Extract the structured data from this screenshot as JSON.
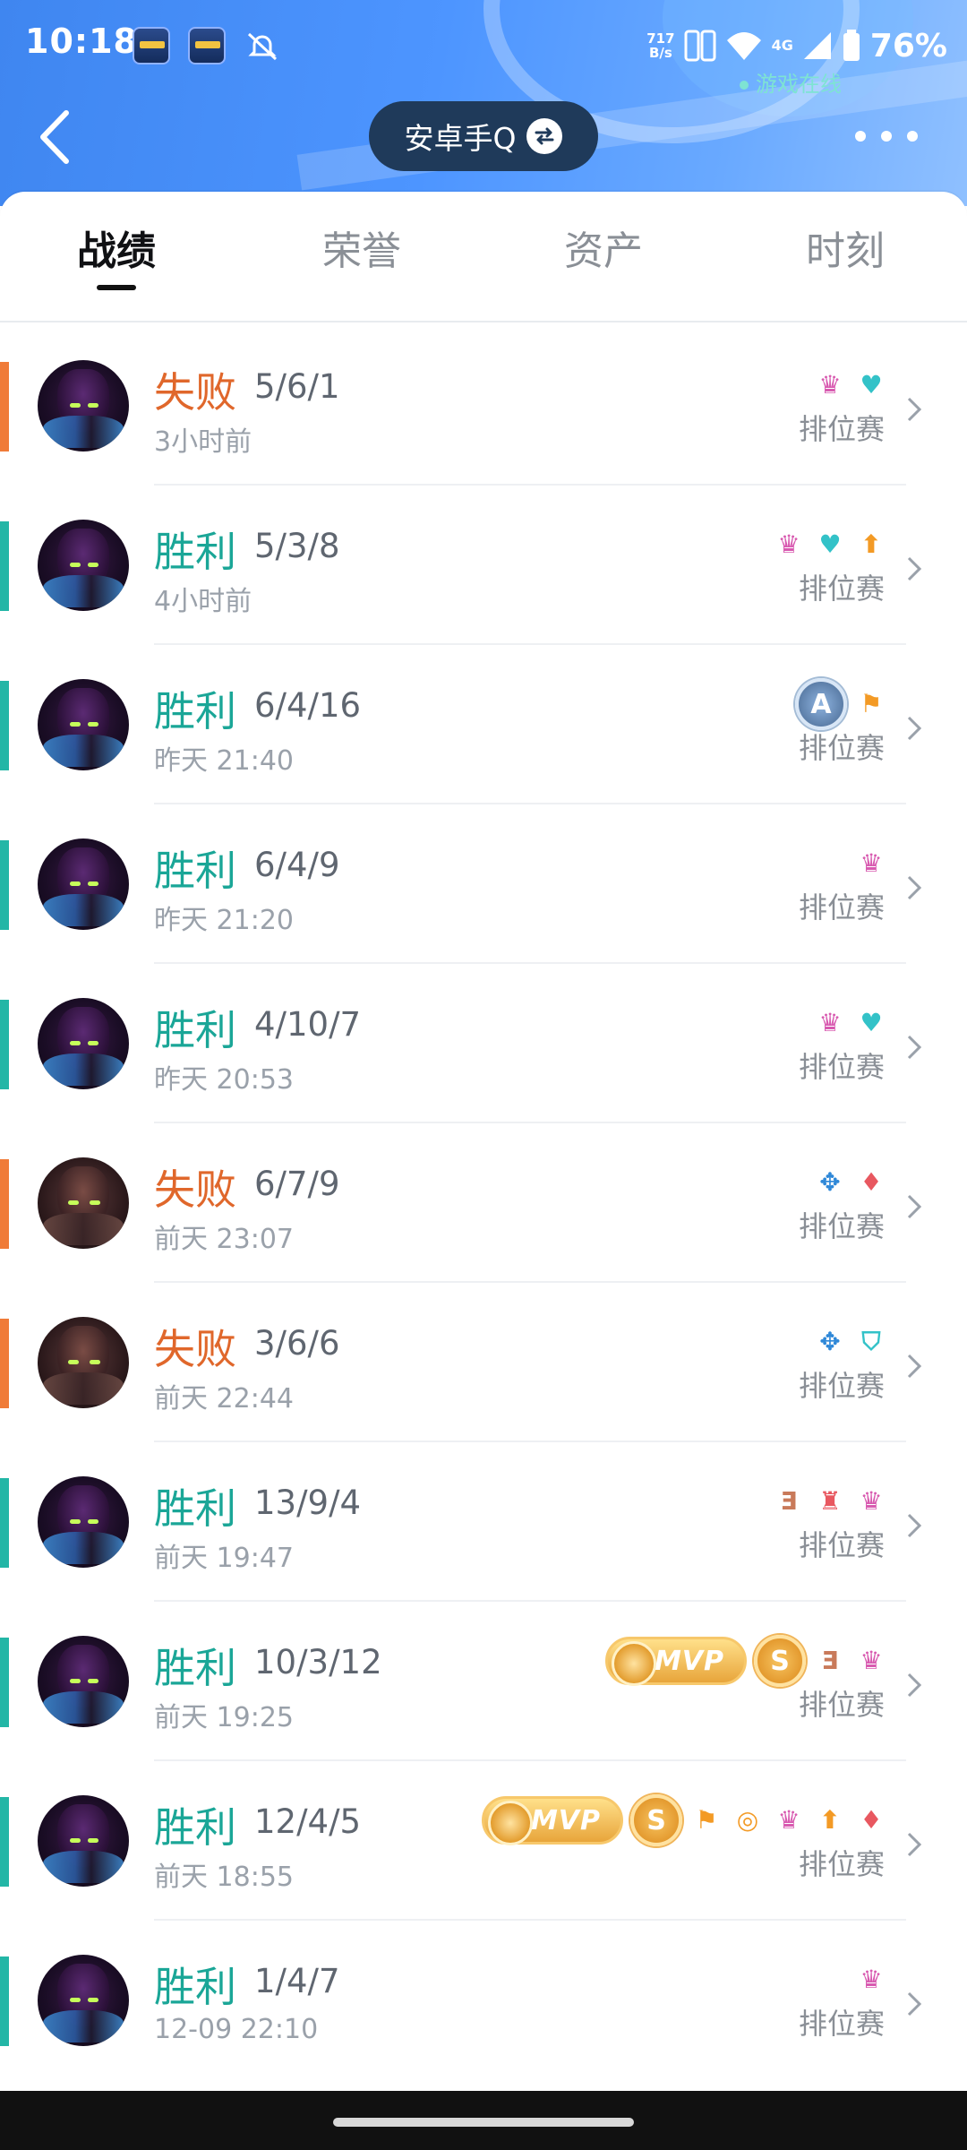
{
  "status_bar": {
    "time": "10:18",
    "net_speed_value": "717",
    "net_speed_unit": "B/s",
    "signal": "4G",
    "battery": "76%",
    "online_text": "游戏在线"
  },
  "header": {
    "account_label": "安卓手Q"
  },
  "tabs": [
    {
      "label": "战绩",
      "active": true
    },
    {
      "label": "荣誉",
      "active": false
    },
    {
      "label": "资产",
      "active": false
    },
    {
      "label": "时刻",
      "active": false
    }
  ],
  "matches": [
    {
      "result": "失败",
      "outcome": "lose",
      "kda": "5/6/1",
      "time": "3小时前",
      "mode": "排位赛",
      "badges": [
        "demon-icon",
        "heart-plus-icon"
      ]
    },
    {
      "result": "胜利",
      "outcome": "win",
      "kda": "5/3/8",
      "time": "4小时前",
      "mode": "排位赛",
      "badges": [
        "demon-icon",
        "heart-plus-icon",
        "coin-up-icon"
      ]
    },
    {
      "result": "胜利",
      "outcome": "win",
      "kda": "6/4/16",
      "time": "昨天 21:40",
      "mode": "排位赛",
      "badges": [
        "rank-a-badge",
        "flag-icon"
      ]
    },
    {
      "result": "胜利",
      "outcome": "win",
      "kda": "6/4/9",
      "time": "昨天 21:20",
      "mode": "排位赛",
      "badges": [
        "demon-icon"
      ]
    },
    {
      "result": "胜利",
      "outcome": "win",
      "kda": "4/10/7",
      "time": "昨天 20:53",
      "mode": "排位赛",
      "badges": [
        "demon-icon",
        "heart-plus-icon"
      ]
    },
    {
      "result": "失败",
      "outcome": "lose",
      "kda": "6/7/9",
      "time": "前天 23:07",
      "mode": "排位赛",
      "badges": [
        "wings-icon",
        "blood-drop-icon"
      ]
    },
    {
      "result": "失败",
      "outcome": "lose",
      "kda": "3/6/6",
      "time": "前天 22:44",
      "mode": "排位赛",
      "badges": [
        "wings-icon",
        "shield-icon"
      ]
    },
    {
      "result": "胜利",
      "outcome": "win",
      "kda": "13/9/4",
      "time": "前天 19:47",
      "mode": "排位赛",
      "badges": [
        "triple-kill-icon",
        "tower-icon",
        "demon-icon"
      ]
    },
    {
      "result": "胜利",
      "outcome": "win",
      "kda": "10/3/12",
      "time": "前天 19:25",
      "mode": "排位赛",
      "badges": [
        "mvp-badge",
        "rank-s-badge",
        "triple-kill-icon",
        "demon-icon"
      ]
    },
    {
      "result": "胜利",
      "outcome": "win",
      "kda": "12/4/5",
      "time": "前天 18:55",
      "mode": "排位赛",
      "badges": [
        "mvp-badge",
        "rank-s-badge",
        "flag-icon",
        "coins-icon",
        "demon-icon",
        "coin-up-icon",
        "blood-drop-icon"
      ]
    },
    {
      "result": "胜利",
      "outcome": "win",
      "kda": "1/4/7",
      "time": "12-09 22:10",
      "mode": "排位赛",
      "badges": [
        "demon-icon"
      ]
    }
  ],
  "badge_text": {
    "mvp": "MVP",
    "rank_a": "A",
    "rank_s": "S"
  },
  "colors": {
    "win": "#1aa697",
    "lose": "#e0672b",
    "header_blue": "#4d95ff"
  }
}
